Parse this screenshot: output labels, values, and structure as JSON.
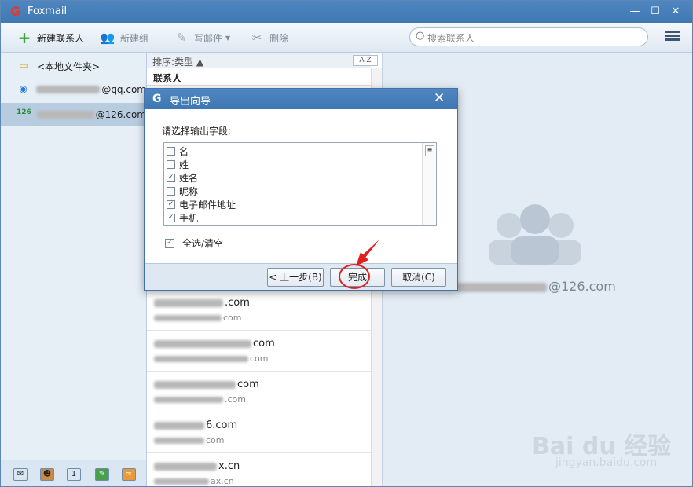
{
  "window": {
    "title": "Foxmail",
    "logo_glyph": "G",
    "min": "—",
    "max": "☐",
    "close": "✕"
  },
  "toolbar": {
    "new_contact": "新建联系人",
    "new_group": "新建组",
    "write_mail": "写邮件",
    "write_mail_arrow": "▾",
    "delete": "删除",
    "search_placeholder": "搜索联系人"
  },
  "accounts": [
    {
      "label": "<本地文件夹>",
      "icon": "folder-icon"
    },
    {
      "label": "@qq.com",
      "icon": "qq-account-icon"
    },
    {
      "label": "@126.com",
      "icon": "126-account-icon",
      "selected": true
    }
  ],
  "contacts_pane": {
    "sort_label": "排序:类型",
    "sort_arrow": "▲",
    "az": "A-Z",
    "group_header": "联系人",
    "cards": [
      {
        "line1": ".com",
        "line2": "com"
      },
      {
        "line1": "com",
        "line2": "com"
      },
      {
        "line1": "com",
        "line2": ".com"
      },
      {
        "line1": "6.com",
        "line2": "com"
      },
      {
        "line1": "x.cn",
        "line2": "ax.cn"
      }
    ]
  },
  "detail": {
    "email": "@126.com"
  },
  "dialog": {
    "title": "导出向导",
    "prompt": "请选择输出字段:",
    "fields": [
      {
        "label": "名",
        "checked": false
      },
      {
        "label": "姓",
        "checked": false
      },
      {
        "label": "姓名",
        "checked": true
      },
      {
        "label": "昵称",
        "checked": false
      },
      {
        "label": "电子邮件地址",
        "checked": true
      },
      {
        "label": "手机",
        "checked": true
      }
    ],
    "select_all": "全选/清空",
    "back": "< 上一步(B)",
    "finish": "完成",
    "cancel": "取消(C)"
  },
  "watermark": {
    "brand": "Bai du 经验",
    "url": "jingyan.baidu.com"
  },
  "colors": {
    "accent": "#3f78b4",
    "annotation": "#e02020"
  }
}
